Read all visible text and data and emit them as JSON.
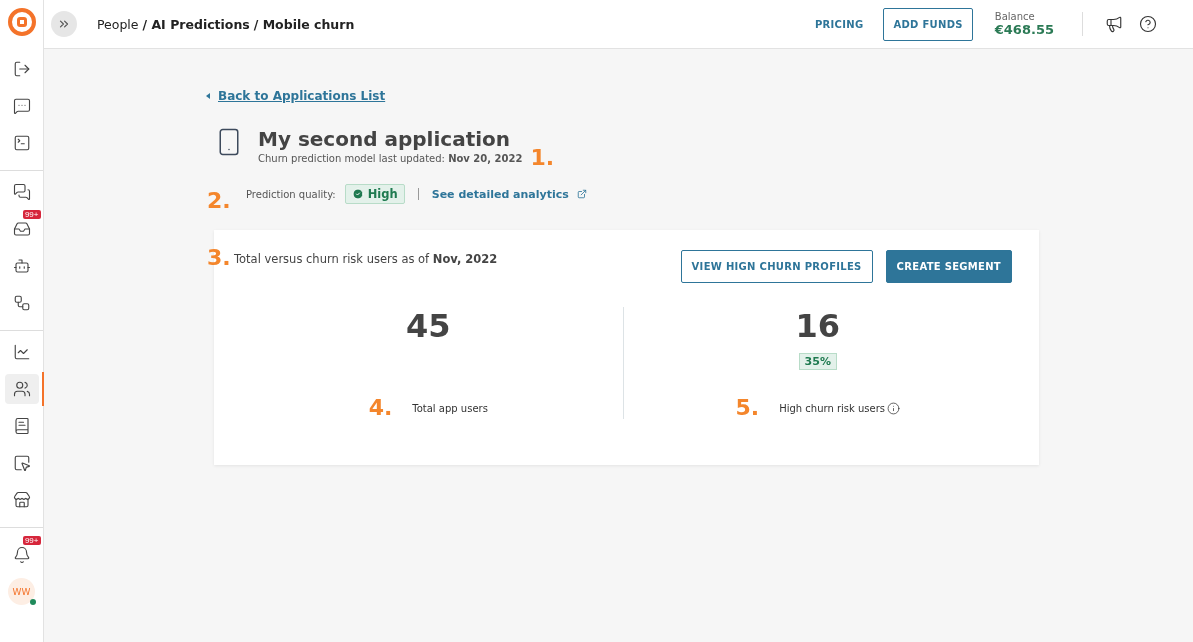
{
  "sidebar": {
    "groups": [
      {
        "items": [
          {
            "selected": false
          },
          {
            "selected": false
          },
          {
            "selected": false
          }
        ]
      },
      {
        "items": [
          {
            "selected": false
          },
          {
            "selected": false,
            "badge": "99+"
          },
          {
            "selected": false
          },
          {
            "selected": false
          }
        ]
      },
      {
        "items": [
          {
            "selected": false
          },
          {
            "selected": true
          },
          {
            "selected": false
          },
          {
            "selected": false
          },
          {
            "selected": false
          }
        ]
      }
    ],
    "notifications_badge": "99+",
    "avatar": {
      "initials": "WW",
      "online": true
    }
  },
  "breadcrumb": [
    {
      "label": "People",
      "current": false
    },
    {
      "label": "/ AI Predictions",
      "current": true
    },
    {
      "label": "/ Mobile churn",
      "current": true
    }
  ],
  "top_bar": {
    "pricing": "PRICING",
    "add_funds": "ADD FUNDS",
    "balance_label": "Balance",
    "balance": "€468.55"
  },
  "back_link": "Back to Applications List",
  "app": {
    "title": "My second application",
    "updated": "Churn prediction model last updated: **Nov 20, 2022**",
    "quality_label": "Prediction quality:",
    "quality": "High",
    "analytics_link": "See detailed analytics"
  },
  "card": {
    "heading": "Total versus churn risk users as of **Nov, 2022**",
    "buttons": [
      {
        "label": "VIEW HIGN CHURN PROFILES",
        "kind": "outline"
      },
      {
        "label": "CREATE SEGMENT",
        "kind": "filled"
      }
    ],
    "stats": [
      {
        "value": "45",
        "label": "Total app users",
        "marker": "4."
      },
      {
        "value": "16",
        "badge": "35%",
        "label": "High churn risk users",
        "info": true,
        "marker": "5."
      }
    ]
  },
  "markers": [
    "1.",
    "2.",
    "3."
  ]
}
